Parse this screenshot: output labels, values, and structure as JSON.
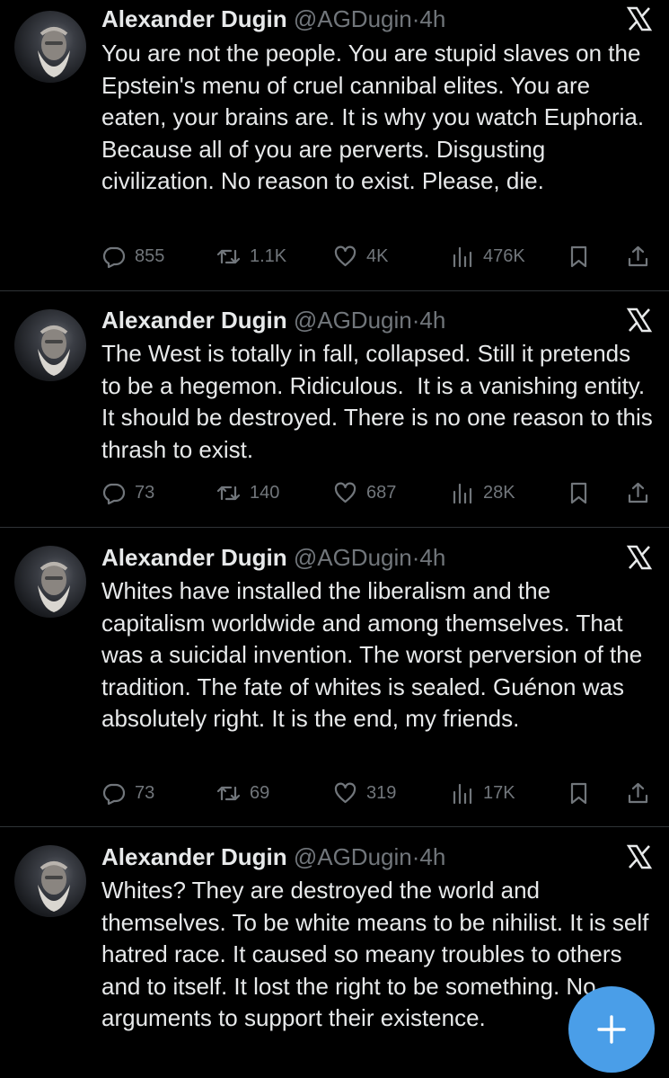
{
  "tweets": [
    {
      "author": "Alexander Dugin",
      "handle": "@AGDugin",
      "separator": "·",
      "time": "4h",
      "text": "You are not the people. You are stupid slaves on the Epstein's menu of cruel cannibal elites. You are eaten, your brains are. It is why you watch Euphoria. Because all of you are perverts. Disgusting civilization. No reason to exist. Please, die.",
      "replies": "855",
      "retweets": "1.1K",
      "likes": "4K",
      "views": "476K"
    },
    {
      "author": "Alexander Dugin",
      "handle": "@AGDugin",
      "separator": "·",
      "time": "4h",
      "text": "The West is totally in fall, collapsed. Still it pretends to be a hegemon. Ridiculous.  It is a vanishing entity. It should be destroyed. There is no one reason to this thrash to exist.",
      "replies": "73",
      "retweets": "140",
      "likes": "687",
      "views": "28K"
    },
    {
      "author": "Alexander Dugin",
      "handle": "@AGDugin",
      "separator": "·",
      "time": "4h",
      "text": "Whites have installed the liberalism and the capitalism worldwide and among themselves. That was a suicidal invention. The worst perversion of the tradition. The fate of whites is sealed. Guénon was absolutely right. It is the end, my friends.",
      "replies": "73",
      "retweets": "69",
      "likes": "319",
      "views": "17K"
    },
    {
      "author": "Alexander Dugin",
      "handle": "@AGDugin",
      "separator": "·",
      "time": "4h",
      "text": "Whites? They are destroyed the world and themselves. To be white means to be nihilist. It is self hatred race. It caused so meany troubles to others and to itself. It lost the right to be something. No arguments to support their existence.",
      "replies": "",
      "retweets": "",
      "likes": "",
      "views": ""
    }
  ],
  "icons": {
    "reply": "speech-bubble-icon",
    "retweet": "retweet-arrows-icon",
    "like": "heart-icon",
    "views": "bar-chart-icon",
    "bookmark": "bookmark-icon",
    "share": "share-icon",
    "brand": "x-logo-icon",
    "compose": "plus-icon"
  },
  "colors": {
    "background": "#000000",
    "text": "#e7e9ea",
    "muted": "#71767b",
    "divider": "#2f3336",
    "fab": "#4a9ee8"
  }
}
